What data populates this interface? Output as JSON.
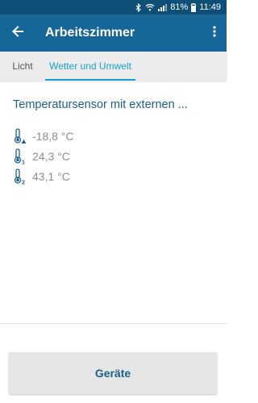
{
  "status_bar": {
    "battery_percent": "81%",
    "time": "11:49",
    "icons": [
      "bluetooth-icon",
      "wifi-icon",
      "signal-icon",
      "battery-icon"
    ]
  },
  "app_bar": {
    "title": "Arbeitszimmer",
    "icons": [
      "back-arrow-icon",
      "more-vert-icon"
    ]
  },
  "tabs": [
    {
      "label": "Licht",
      "selected": false
    },
    {
      "label": "Wetter und Umwelt",
      "selected": true
    }
  ],
  "sensor": {
    "title": "Temperatursensor mit externen ...",
    "readings": [
      {
        "index": "△",
        "value": "-18,8 °C"
      },
      {
        "index": "1",
        "value": "24,3 °C"
      },
      {
        "index": "2",
        "value": "43,1 °C"
      }
    ]
  },
  "bottom_button": {
    "label": "Geräte"
  },
  "colors": {
    "status_bar": "#0d4f76",
    "app_bar": "#17669a",
    "accent": "#1a9fd0",
    "title_text": "#1d5f8a",
    "value_text": "#8e8e8e"
  }
}
